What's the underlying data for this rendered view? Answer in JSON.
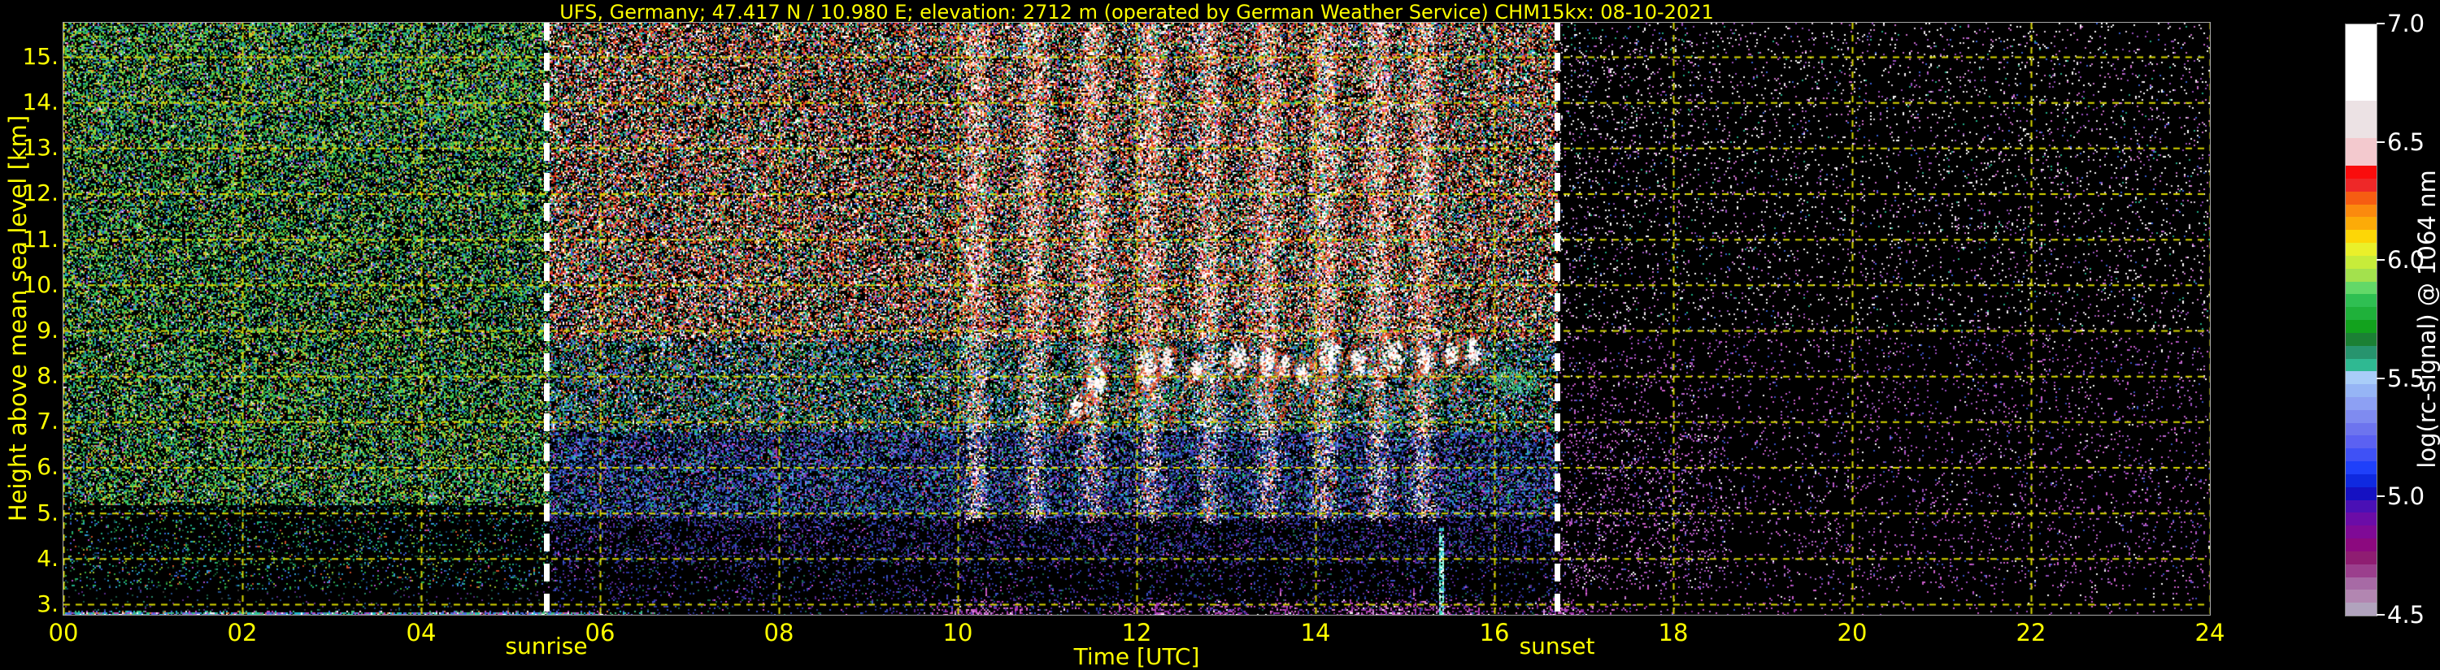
{
  "chart_data": {
    "type": "heatmap",
    "title": "UFS, Germany; 47.417 N / 10.980 E; elevation: 2712 m  (operated by German Weather Service)    CHM15kx: 08-10-2021",
    "station": "UFS, Germany",
    "latitude": "47.417 N",
    "longitude": "10.980 E",
    "elevation": "2712 m",
    "operator": "operated by German Weather Service",
    "instrument": "CHM15kx",
    "date": "08-10-2021",
    "xlabel": "Time [UTC]",
    "ylabel": "Height above mean sea level [km]",
    "x_ticks": [
      "00",
      "02",
      "04",
      "06",
      "08",
      "10",
      "12",
      "14",
      "16",
      "18",
      "20",
      "22",
      "24"
    ],
    "x_tick_hours": [
      0,
      2,
      4,
      6,
      8,
      10,
      12,
      14,
      16,
      18,
      20,
      22,
      24
    ],
    "x_range_hours": [
      0,
      24
    ],
    "y_ticks": [
      "15.",
      "14.",
      "13.",
      "12.",
      "11.",
      "10.",
      "9.",
      "8.",
      "7.",
      "6.",
      "5.",
      "4.",
      "3."
    ],
    "y_tick_values": [
      15,
      14,
      13,
      12,
      11,
      10,
      9,
      8,
      7,
      6,
      5,
      4,
      3
    ],
    "y_range_km": [
      2.79,
      15.8
    ],
    "grid": "yellow dashed gridlines every 1 km and every 2 h",
    "annotations": [
      {
        "label": "sunrise",
        "time_utc": "≈05:25",
        "style": "vertical white dashed line"
      },
      {
        "label": "sunset",
        "time_utc": "≈16:42",
        "style": "vertical white dashed line"
      }
    ],
    "colorbar": {
      "label": "log(rc-signal) @ 1064 nm",
      "tick_labels": [
        "7.0",
        "6.5",
        "6.0",
        "5.5",
        "5.0",
        "4.5"
      ],
      "tick_values": [
        7.0,
        6.5,
        6.0,
        5.5,
        5.0,
        4.5
      ],
      "range": [
        4.5,
        7.0
      ],
      "bands_top_to_bottom": [
        [
          "#ffffff",
          13.0
        ],
        [
          "#ece2e4",
          6.4
        ],
        [
          "#f3c9ce",
          4.8
        ],
        [
          "#fa0d0d",
          2.2
        ],
        [
          "#ee2828",
          2.2
        ],
        [
          "#f65d12",
          2.2
        ],
        [
          "#fb8a0e",
          2.2
        ],
        [
          "#fcab08",
          2.2
        ],
        [
          "#fdd606",
          2.2
        ],
        [
          "#eaf02a",
          2.2
        ],
        [
          "#c7ec3a",
          2.2
        ],
        [
          "#a3e14d",
          2.2
        ],
        [
          "#63d868",
          2.2
        ],
        [
          "#2fbf52",
          2.2
        ],
        [
          "#1fb13a",
          2.2
        ],
        [
          "#12a21d",
          2.2
        ],
        [
          "#1b8034",
          2.2
        ],
        [
          "#27946e",
          2.2
        ],
        [
          "#2fb992",
          2.2
        ],
        [
          "#a9cdf8",
          2.2
        ],
        [
          "#96b5f5",
          2.2
        ],
        [
          "#8da0f3",
          2.2
        ],
        [
          "#7f8bf0",
          2.2
        ],
        [
          "#6d74ee",
          2.2
        ],
        [
          "#5b61f2",
          2.2
        ],
        [
          "#3f51f6",
          2.2
        ],
        [
          "#1f40fa",
          2.2
        ],
        [
          "#0f29e0",
          2.2
        ],
        [
          "#1511c2",
          2.2
        ],
        [
          "#4a10b5",
          2.2
        ],
        [
          "#6b0ca7",
          2.2
        ],
        [
          "#7f0a96",
          2.2
        ],
        [
          "#8c097f",
          2.2
        ],
        [
          "#8f1d72",
          2.2
        ],
        [
          "#9b3f8d",
          2.2
        ],
        [
          "#a76aa5",
          2.2
        ],
        [
          "#b286b1",
          2.2
        ],
        [
          "#b1a3bd",
          2.2
        ]
      ]
    },
    "features": [
      "dense green/teal/yellow speckle noise before sunrise (00:00–05:25 UTC), darker below ≈5 km",
      "bright multicolour daytime noise (05:25–16:42 UTC): red/orange/white tint above ≈9 km, blue/indigo below ≈7 km, with brighter vertical streaks between ≈10:00 and 15:30 UTC",
      "scattered cloud echoes with white cores and red/orange fringes at 7–8.6 km between ≈11:20 and 15:20 UTC",
      "green/teal cloud remnant near 8 km around ≈15:50–16:30 UTC",
      "magenta aerosol band just above 3 km from ≈09:15 to ≈17:25 UTC",
      "narrow bright cyan echo column below ≈4.6 km near ≈15:24 UTC",
      "thin multicolour near-surface signal line at ≈3 km from 00:00 to ≈06:45 UTC",
      "sparse purple and white speckle on black after sunset (16:42–24:00 UTC)"
    ]
  },
  "colors": {
    "axis_text": "#ffff00",
    "grid": "#d8d800",
    "background": "#000000",
    "sun_line": "#ffffff",
    "colorbar_text": "#ffffff",
    "spine": "#a8a8a8"
  }
}
